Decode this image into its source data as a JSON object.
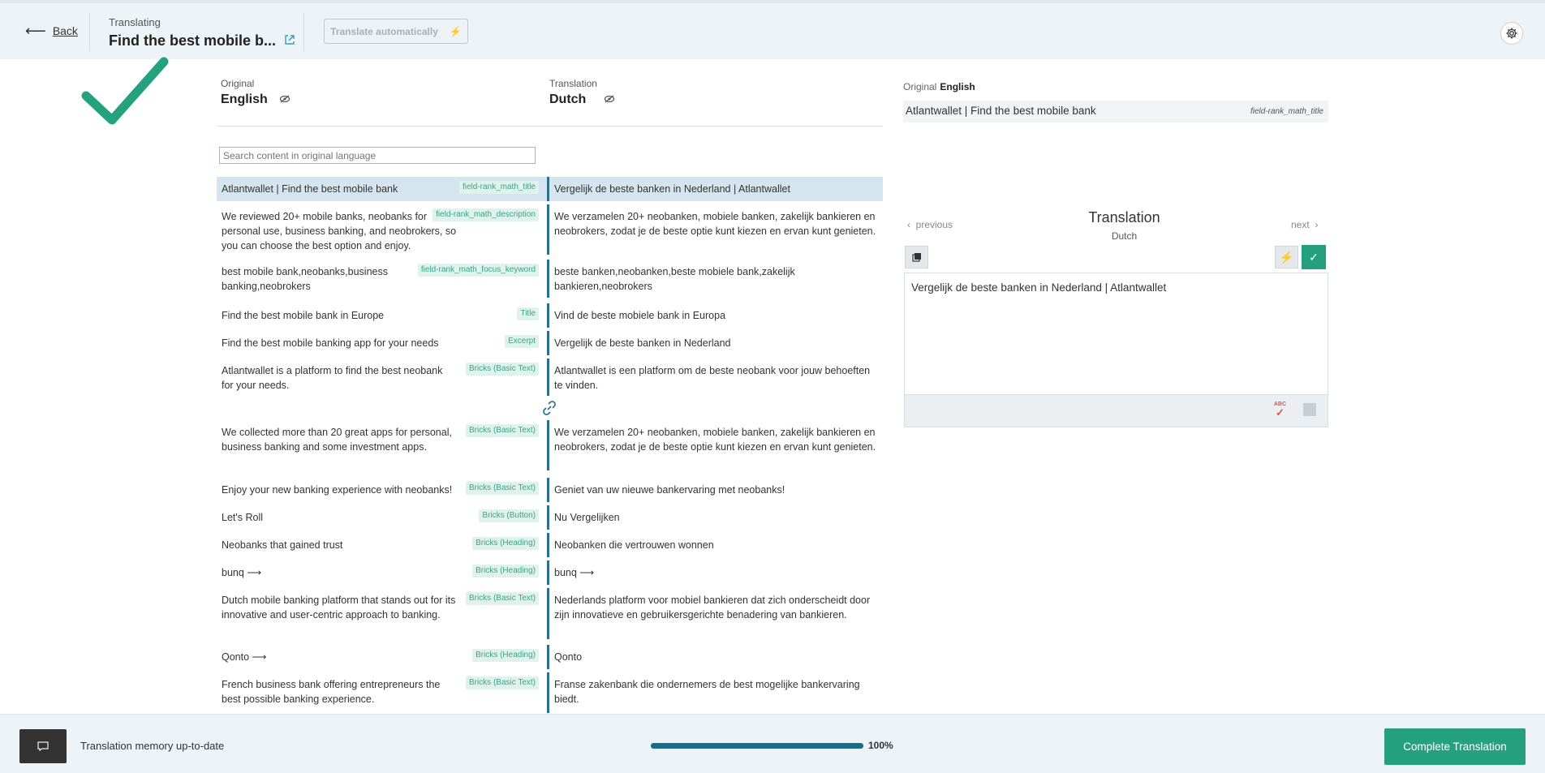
{
  "header": {
    "back_label": "Back",
    "translating_label": "Translating",
    "page_title": "Find the best mobile b...",
    "translate_auto_label": "Translate automatically"
  },
  "columns": {
    "original_small": "Original",
    "original_lang": "English",
    "translation_small": "Translation",
    "translation_lang": "Dutch"
  },
  "search": {
    "placeholder": "Search content in original language"
  },
  "rows": [
    {
      "original": "Atlantwallet | Find the best mobile bank",
      "tag": "field-rank_math_title",
      "translation": "Vergelijk de beste banken in Nederland | Atlantwallet"
    },
    {
      "original": "We reviewed 20+ mobile banks, neobanks for personal use, business banking, and neobrokers, so you can choose the best option and enjoy.",
      "tag": "field-rank_math_description",
      "translation": "We verzamelen 20+ neobanken, mobiele banken, zakelijk bankieren en neobrokers, zodat je de beste optie kunt kiezen en ervan kunt genieten."
    },
    {
      "original": "best mobile bank,neobanks,business banking,neobrokers",
      "tag": "field-rank_math_focus_keyword",
      "translation": "beste banken,neobanken,beste mobiele bank,zakelijk bankieren,neobrokers"
    },
    {
      "original": "Find the best mobile bank in Europe",
      "tag": "Title",
      "translation": "Vind de beste mobiele bank in Europa"
    },
    {
      "original": "Find the best mobile banking app for your needs",
      "tag": "Excerpt",
      "translation": "Vergelijk de beste banken in Nederland"
    },
    {
      "original": "Atlantwallet is a platform to find the best neobank for your needs.",
      "tag": "Bricks (Basic Text)",
      "translation": "Atlantwallet is een platform om de beste neobank voor jouw behoeften te vinden."
    },
    {
      "original": "We collected more than 20 great apps for personal, business banking and some investment apps.",
      "tag": "Bricks (Basic Text)",
      "translation": "We verzamelen 20+ neobanken, mobiele banken, zakelijk bankieren en neobrokers, zodat je de beste optie kunt kiezen en ervan kunt genieten."
    },
    {
      "original": "Enjoy your new banking experience with neobanks!",
      "tag": "Bricks (Basic Text)",
      "translation": "Geniet van uw nieuwe bankervaring met neobanks!"
    },
    {
      "original": "Let's Roll",
      "tag": "Bricks (Button)",
      "translation": "Nu Vergelijken"
    },
    {
      "original": "Neobanks that gained trust",
      "tag": "Bricks (Heading)",
      "translation": "Neobanken die vertrouwen wonnen"
    },
    {
      "original": "bunq ⟶",
      "tag": "Bricks (Heading)",
      "translation": "bunq ⟶"
    },
    {
      "original": "Dutch mobile banking platform that stands out for its innovative and user-centric approach to banking.",
      "tag": "Bricks (Basic Text)",
      "translation": "Nederlands platform voor mobiel bankieren dat zich onderscheidt door zijn innovatieve en gebruikersgerichte benadering van bankieren."
    },
    {
      "original": "Qonto ⟶",
      "tag": "Bricks (Heading)",
      "translation": "Qonto"
    },
    {
      "original": "French business bank offering entrepreneurs the best possible banking experience.",
      "tag": "Bricks (Basic Text)",
      "translation": "Franse zakenbank die ondernemers de best mogelijke bankervaring biedt."
    }
  ],
  "right_panel": {
    "original_label": "Original",
    "original_lang": "English",
    "original_text": "Atlantwallet | Find the best mobile bank",
    "original_tag": "field-rank_math_title",
    "previous_label": "previous",
    "next_label": "next",
    "translation_title": "Translation",
    "translation_lang": "Dutch",
    "editor_text": "Vergelijk de beste banken in Nederland | Atlantwallet",
    "spell_label": "ABC"
  },
  "footer": {
    "tm_status": "Translation memory up-to-date",
    "progress_percent": 100,
    "progress_label": "100%",
    "complete_label": "Complete Translation"
  },
  "colors": {
    "accent": "#26a17f",
    "row_bar": "#2a6f8b",
    "active_row": "#d5e5f0",
    "header_bg": "#edf3f6"
  }
}
